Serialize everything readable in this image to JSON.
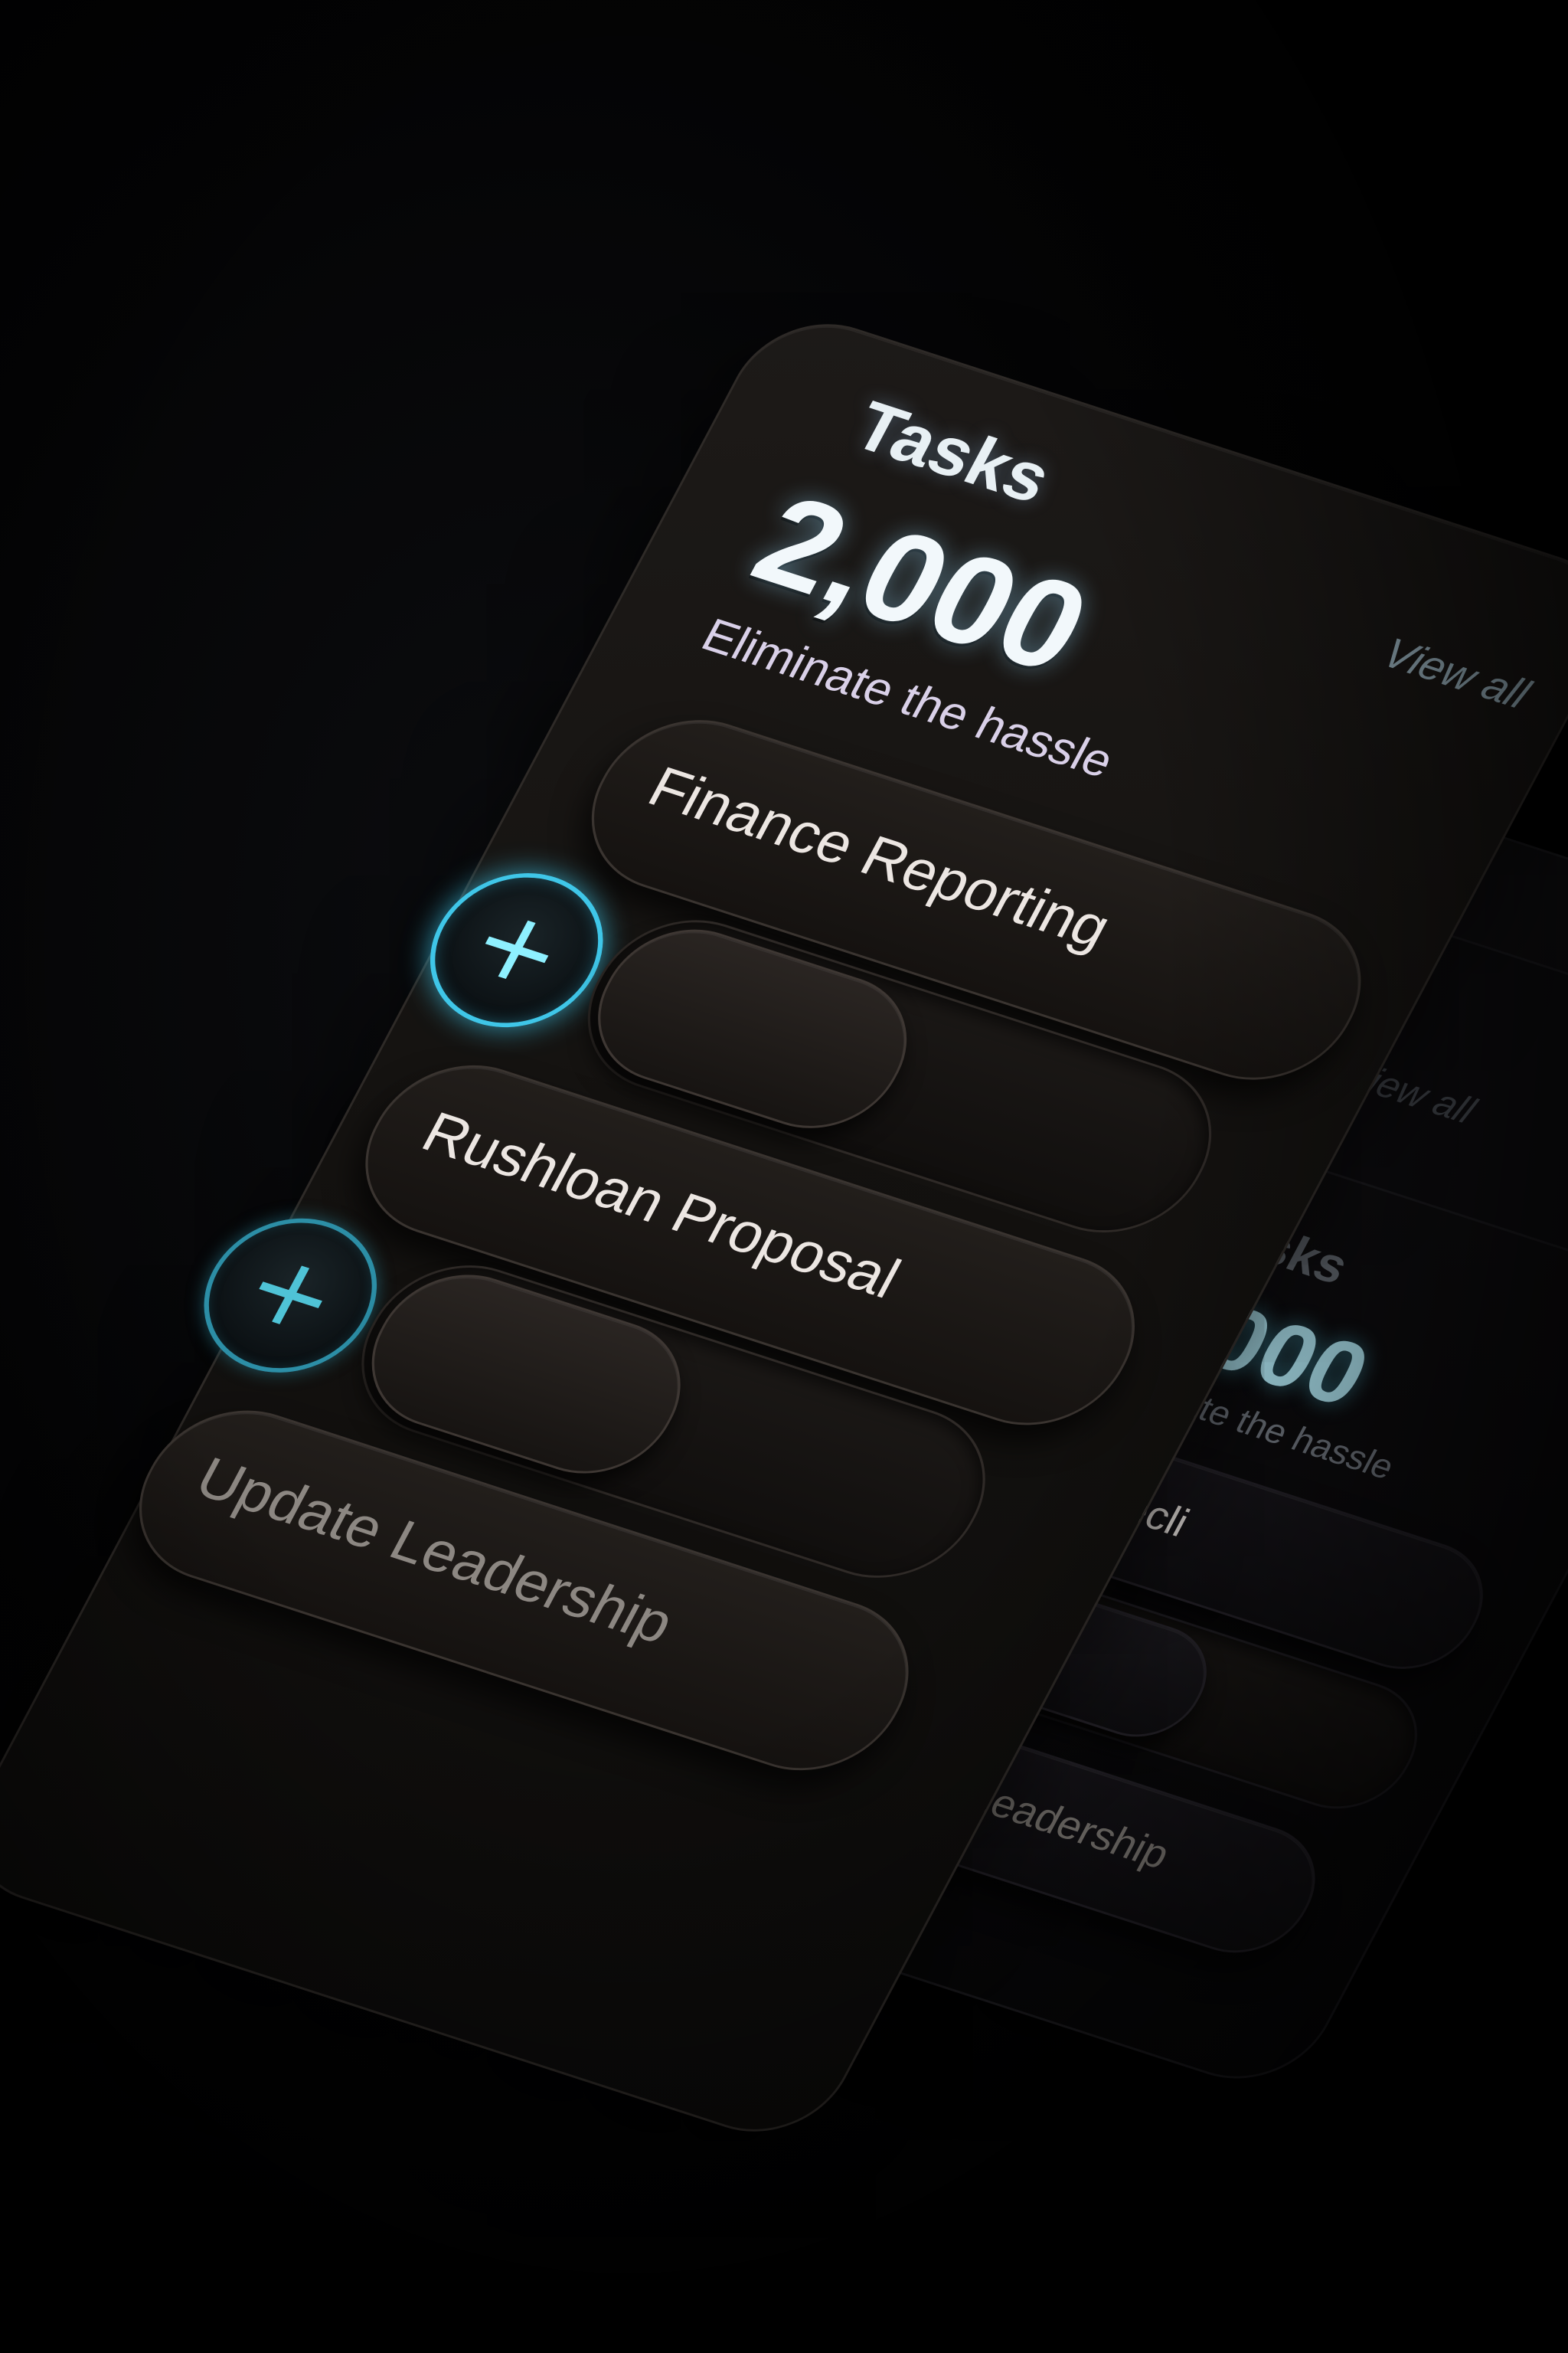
{
  "main_card": {
    "title": "Tasks",
    "view_all": "View all",
    "count": "2,000",
    "subtitle": "Eliminate the hassle",
    "tasks": [
      {
        "label": "Finance Reporting"
      },
      {
        "label": "Rushloan Proposal"
      },
      {
        "label": "Update Leadership"
      }
    ],
    "plus_glyph": "+"
  },
  "back_card": {
    "view_all": "View all",
    "title": "Tasks",
    "count": "2,000",
    "subtitle": "Eliminate the hassle",
    "tasks": [
      {
        "label": "Presecli"
      },
      {
        "label": "Update Leadership"
      }
    ],
    "plus_glyph": "+"
  },
  "colors": {
    "accent": "#3fc6e8",
    "background": "#000000",
    "card": "#141210"
  },
  "icons": [
    "plus-icon"
  ]
}
